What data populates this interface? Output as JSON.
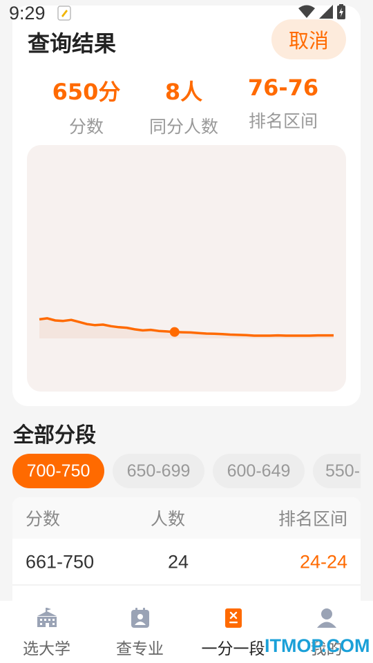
{
  "status_bar": {
    "time": "9:29"
  },
  "result_card": {
    "title": "查询结果",
    "cancel_label": "取消",
    "stats": [
      {
        "value": "650分",
        "label": "分数"
      },
      {
        "value": "8人",
        "label": "同分人数"
      },
      {
        "value": "76-76",
        "label": "排名区间"
      }
    ]
  },
  "chart_data": {
    "type": "line",
    "series": [
      {
        "values": [
          0.62,
          0.66,
          0.58,
          0.56,
          0.6,
          0.52,
          0.44,
          0.4,
          0.42,
          0.36,
          0.32,
          0.3,
          0.24,
          0.2,
          0.22,
          0.18,
          0.16,
          0.14,
          0.13,
          0.12,
          0.1,
          0.08,
          0.07,
          0.06,
          0.04,
          0.03,
          0.02,
          0.0,
          0.0,
          0.0,
          0.01,
          0.0,
          0.0,
          0.0,
          0.0,
          0.01,
          0.01,
          0.01
        ]
      }
    ],
    "highlight_index": 17,
    "colors": {
      "line": "#ff6a00",
      "area": "#f4e5de"
    }
  },
  "segments": {
    "title": "全部分段",
    "chips": [
      "700-750",
      "650-699",
      "600-649",
      "550-"
    ],
    "active_index": 0
  },
  "table": {
    "headers": [
      "分数",
      "人数",
      "排名区间"
    ],
    "rows": [
      [
        "661-750",
        "24",
        "24-24"
      ]
    ]
  },
  "bottom_nav": {
    "items": [
      "选大学",
      "查专业",
      "一分一段",
      "我的"
    ],
    "active_index": 2
  },
  "watermark": "ITMOP.COM",
  "colors": {
    "accent": "#ff6a00",
    "accent_light": "#fdebdc"
  }
}
